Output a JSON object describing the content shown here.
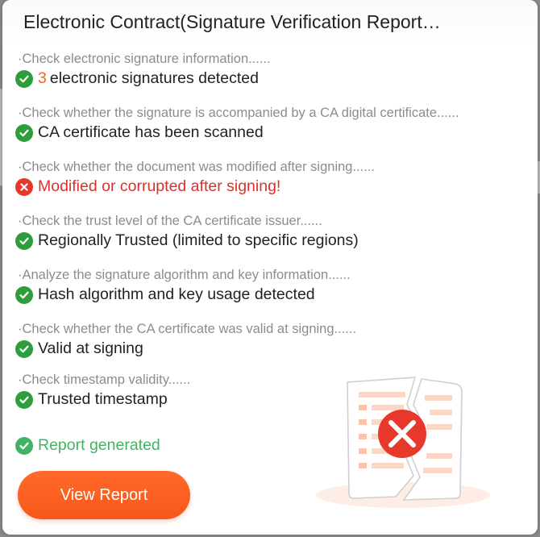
{
  "dialog": {
    "title": "Electronic Contract(Signature Verification Report…"
  },
  "steps": [
    {
      "desc": "·Check electronic signature information......",
      "count": "3",
      "result": "electronic signatures detected",
      "status": "ok"
    },
    {
      "desc": "·Check whether the signature is accompanied by a CA digital certificate......",
      "result": "CA certificate has been scanned",
      "status": "ok"
    },
    {
      "desc": "·Check whether the document was modified after signing......",
      "result": "Modified or corrupted after signing!",
      "status": "fail"
    },
    {
      "desc": "·Check the trust level of the CA certificate issuer......",
      "result": "Regionally Trusted (limited to specific regions)",
      "status": "ok"
    },
    {
      "desc": "·Analyze the signature algorithm and key information......",
      "result": "Hash algorithm and key usage detected",
      "status": "ok"
    },
    {
      "desc": "·Check whether the CA certificate was valid at signing......",
      "result": "Valid at signing",
      "status": "ok"
    },
    {
      "desc": "·Check timestamp validity......",
      "result": "Trusted timestamp",
      "status": "ok"
    }
  ],
  "report_status": "Report generated",
  "view_report_label": "View Report",
  "colors": {
    "accent": "#f7571a",
    "ok": "#2e9e3d",
    "fail": "#e5392c",
    "generated_text": "#41b463"
  },
  "icons": {
    "ok": "check-circle-icon",
    "fail": "x-circle-icon",
    "illustration": "torn-document-error-illustration"
  }
}
